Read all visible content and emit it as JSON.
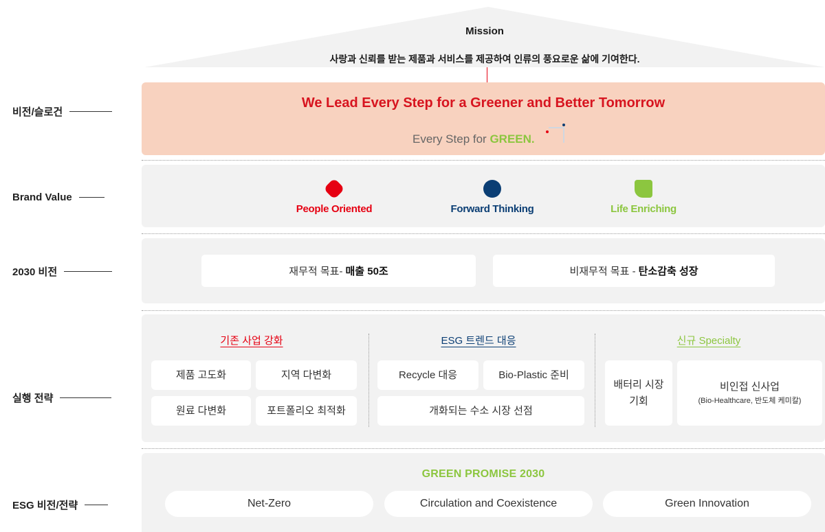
{
  "mission": {
    "title": "Mission",
    "text": "사랑과 신뢰를 받는 제품과 서비스를 제공하여 인류의 풍요로운 삶에 기여한다."
  },
  "labels": {
    "vision": "비전/슬로건",
    "brand_value": "Brand Value",
    "vision_2030": "2030 비전",
    "strategy": "실행 전략",
    "esg": "ESG 비전/전략"
  },
  "vision": {
    "slogan": "We Lead Every Step for a Greener and Better Tomorrow",
    "tagline_prefix": "Every Step for ",
    "tagline_green": "GREEN."
  },
  "brand_values": [
    {
      "label": "People Oriented",
      "color": "#e60012",
      "icon": "red-diamond-icon"
    },
    {
      "label": "Forward Thinking",
      "color": "#0b3e74",
      "icon": "blue-circle-icon"
    },
    {
      "label": "Life Enriching",
      "color": "#8cc63f",
      "icon": "green-leaf-icon"
    }
  ],
  "vision_2030": {
    "financial_prefix": "재무적 목표-",
    "financial_bold": "매출 50조",
    "nonfinancial_prefix": "비재무적 목표 -",
    "nonfinancial_bold": "탄소감축 성장"
  },
  "strategy": {
    "columns": [
      {
        "title": "기존 사업 강화",
        "color": "#e60012",
        "items": [
          "제품 고도화",
          "지역 다변화",
          "원료 다변화",
          "포트폴리오 최적화"
        ]
      },
      {
        "title": "ESG 트렌드 대응",
        "color": "#0b3e74",
        "items": [
          "Recycle 대응",
          "Bio-Plastic 준비",
          "개화되는 수소 시장 선점"
        ]
      },
      {
        "title": "신규 Specialty",
        "color": "#8cc63f",
        "items": [
          "배터리 시장 기회",
          "비인접 신사업"
        ],
        "note": "(Bio-Healthcare, 반도체 케미칼)"
      }
    ]
  },
  "esg": {
    "title": "GREEN PROMISE 2030",
    "items": [
      "Net-Zero",
      "Circulation and Coexistence",
      "Green Innovation"
    ]
  },
  "colors": {
    "red": "#e60012",
    "navy": "#0b3e74",
    "green": "#8cc63f",
    "vision_band": "#f8d2bf",
    "band": "#f2f2f2"
  }
}
